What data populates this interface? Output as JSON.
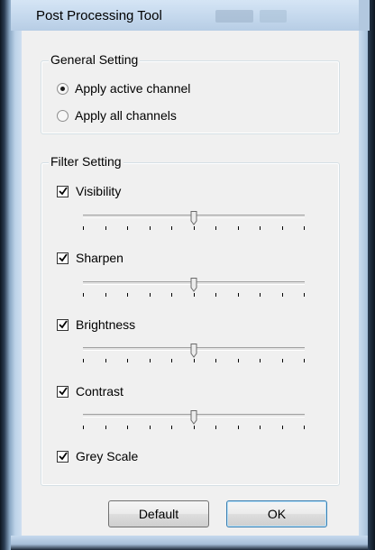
{
  "window": {
    "title": "Post Processing Tool"
  },
  "general": {
    "label": "General Setting",
    "options": [
      {
        "label": "Apply active channel",
        "checked": true
      },
      {
        "label": "Apply all channels",
        "checked": false
      }
    ]
  },
  "filter": {
    "label": "Filter Setting",
    "items": [
      {
        "label": "Visibility",
        "checked": true,
        "slider_fraction": 0.5
      },
      {
        "label": "Sharpen",
        "checked": true,
        "slider_fraction": 0.5
      },
      {
        "label": "Brightness",
        "checked": true,
        "slider_fraction": 0.5
      },
      {
        "label": "Contrast",
        "checked": true,
        "slider_fraction": 0.5
      },
      {
        "label": "Grey Scale",
        "checked": true
      }
    ]
  },
  "buttons": {
    "default_label": "Default",
    "ok_label": "OK"
  },
  "icons": {
    "checkbox_mark": "checkmark-icon"
  }
}
